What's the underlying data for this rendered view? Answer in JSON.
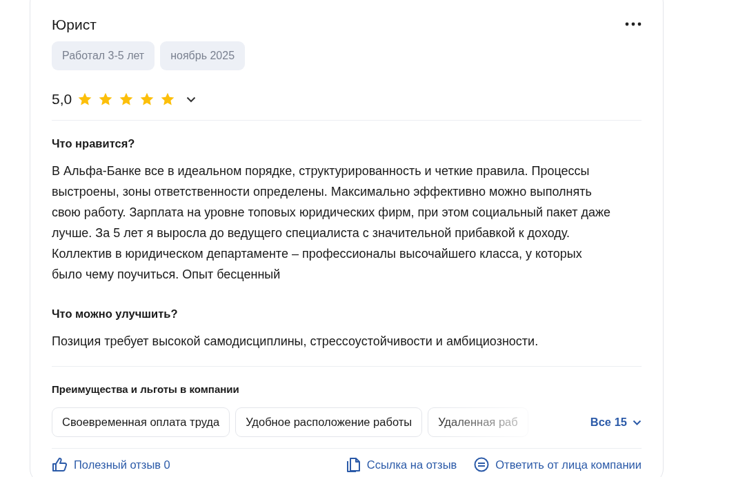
{
  "review": {
    "title": "Юрист",
    "tags": [
      "Работал 3-5 лет",
      "ноябрь 2025"
    ],
    "rating": "5,0",
    "stars": 5,
    "sections": [
      {
        "heading": "Что нравится?",
        "text": "В Альфа-Банке все в идеальном порядке, структурированность и четкие правила. Процессы выстроены, зоны ответственности определены. Максимально эффективно можно выполнять свою работу. Зарплата на уровне топовых юридических фирм, при этом социальный пакет даже лучше. За 5 лет я выросла до ведущего специалиста с значительной прибавкой к доходу. Коллектив в юридическом департаменте – профессионалы высочайшего класса, у которых было чему поучиться. Опыт бесценный"
      },
      {
        "heading": "Что можно улучшить?",
        "text": "Позиция требует высокой самодисциплины, стрессоустойчивости и амбициозности."
      }
    ],
    "benefits": {
      "heading": "Преимущества и льготы в компании",
      "items": [
        "Своевременная оплата труда",
        "Удобное расположение работы",
        "Удаленная раб"
      ],
      "more": "Все 15"
    },
    "actions": [
      {
        "kind": "helpful",
        "label": "Полезный отзыв 0"
      },
      {
        "kind": "link",
        "label": "Ссылка на отзыв"
      },
      {
        "kind": "reply",
        "label": "Ответить от лица компании"
      }
    ]
  }
}
